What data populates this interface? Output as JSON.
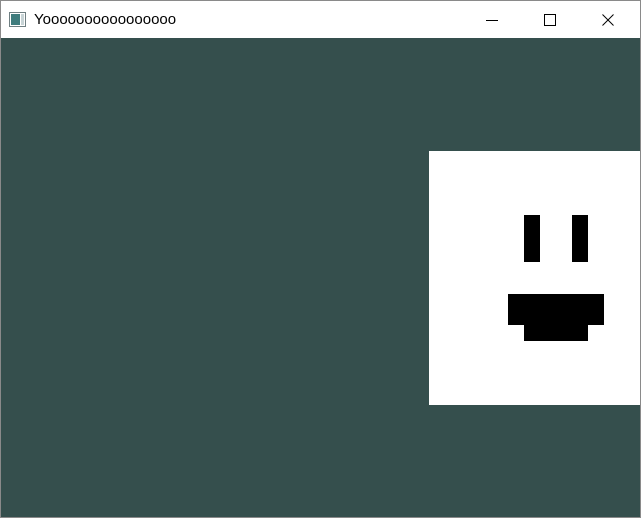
{
  "window": {
    "title": "Yoooooooooooooooo",
    "icon": "app-window-icon",
    "controls": {
      "minimize_icon": "minimize-icon",
      "maximize_icon": "maximize-icon",
      "close_icon": "close-icon"
    }
  },
  "scene": {
    "background_color": "#354f4d",
    "face": {
      "color": "#ffffff",
      "feature_color": "#000000",
      "features": [
        "left-eye",
        "right-eye",
        "mouth"
      ]
    }
  }
}
